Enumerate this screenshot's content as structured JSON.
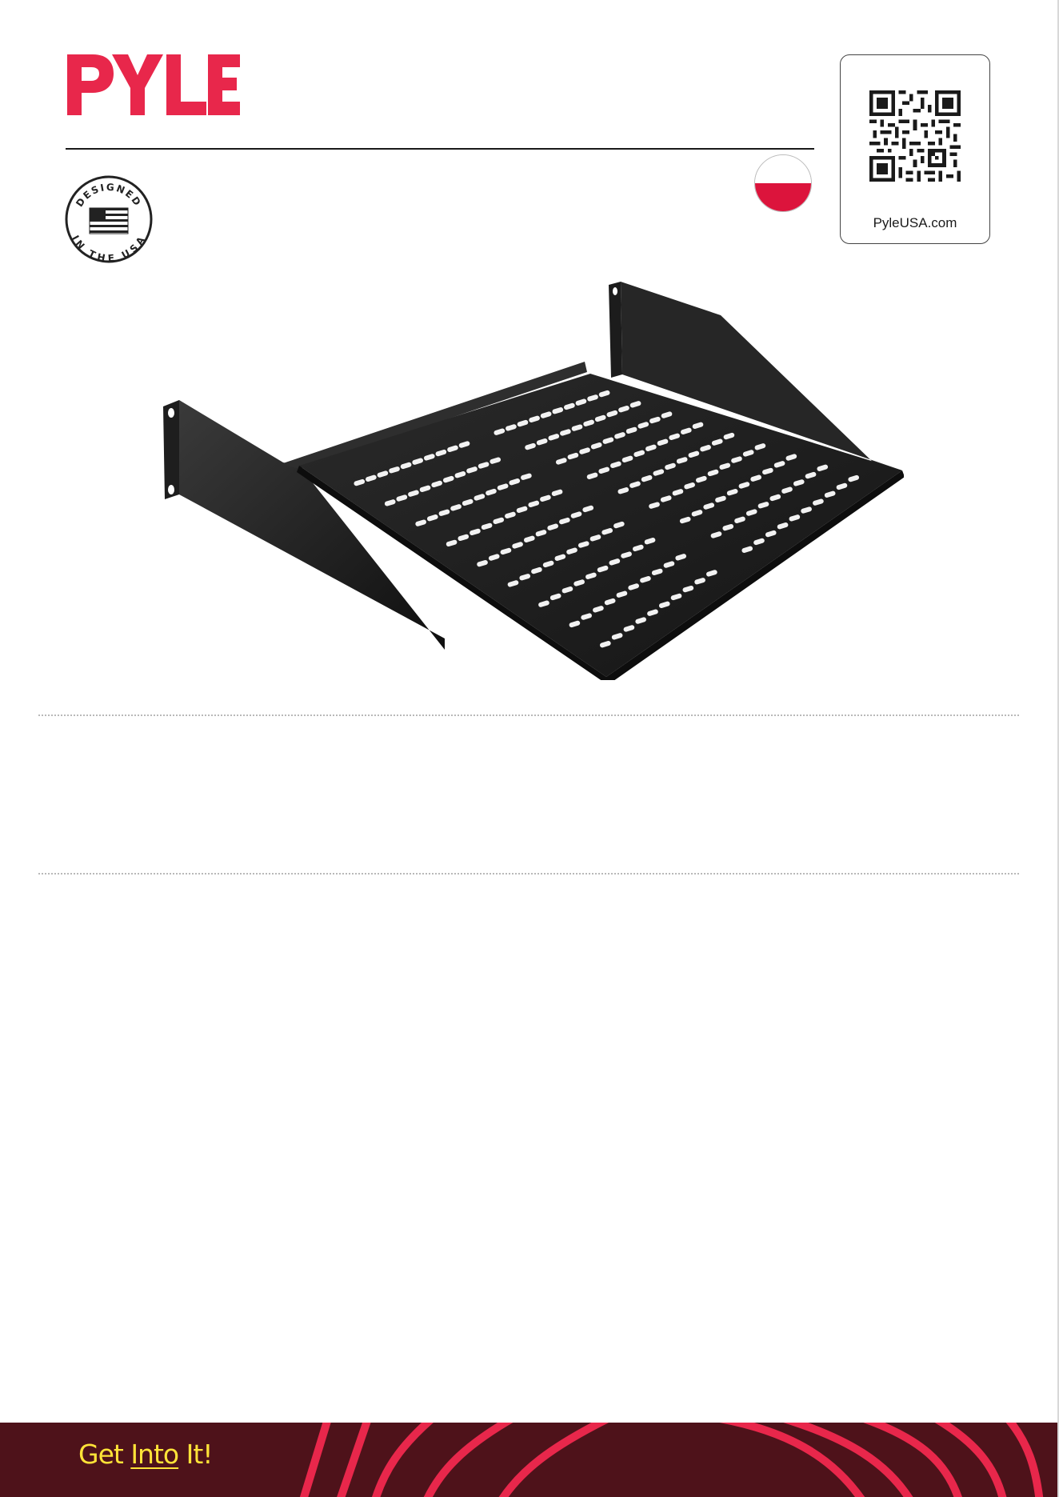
{
  "brand": {
    "name": "PYLE",
    "color": "#e8274b"
  },
  "badge": {
    "top_text": "DESIGNED",
    "bottom_text": "IN THE USA",
    "icon": "us-flag-icon"
  },
  "language_flag": {
    "icon": "poland-flag-icon",
    "colors": [
      "#ffffff",
      "#dc143c"
    ]
  },
  "qr": {
    "url_label": "PyleUSA.com",
    "icon": "qr-code-icon"
  },
  "product_image": {
    "icon": "rack-shelf-image"
  },
  "footer": {
    "tagline_before": "Get ",
    "tagline_underlined": "Into",
    "tagline_after": " It!",
    "background": "#4e121a",
    "accent": "#e8274b",
    "tagline_color": "#ffe338"
  }
}
